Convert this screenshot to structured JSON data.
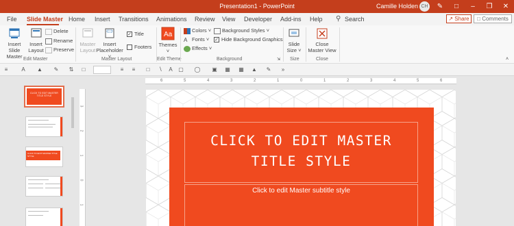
{
  "titlebar": {
    "title": "Presentation1  -  PowerPoint",
    "user_name": "Camille Holden",
    "avatar_initials": "CH"
  },
  "tabs": [
    {
      "label": "File"
    },
    {
      "label": "Slide Master"
    },
    {
      "label": "Home"
    },
    {
      "label": "Insert"
    },
    {
      "label": "Transitions"
    },
    {
      "label": "Animations"
    },
    {
      "label": "Review"
    },
    {
      "label": "View"
    },
    {
      "label": "Developer"
    },
    {
      "label": "Add-ins"
    },
    {
      "label": "Help"
    }
  ],
  "search_label": "Search",
  "share_label": "Share",
  "comments_label": "Comments",
  "ribbon": {
    "edit_master": {
      "label": "Edit Master",
      "insert_slide_master": "Insert Slide\nMaster",
      "insert_layout": "Insert\nLayout",
      "delete": "Delete",
      "rename": "Rename",
      "preserve": "Preserve"
    },
    "master_layout": {
      "label": "Master Layout",
      "master_layout_btn": "Master\nLayout",
      "insert_placeholder": "Insert\nPlaceholder",
      "title_cb": "Title",
      "footers_cb": "Footers"
    },
    "edit_theme": {
      "label": "Edit Theme",
      "themes": "Themes"
    },
    "background": {
      "label": "Background",
      "colors": "Colors",
      "fonts": "Fonts",
      "effects": "Effects",
      "background_styles": "Background Styles",
      "hide_bg_graphics": "Hide Background Graphics"
    },
    "size": {
      "label": "Size",
      "slide_size": "Slide\nSize"
    },
    "close": {
      "label": "Close",
      "close_master_view": "Close\nMaster View"
    }
  },
  "ruler_numbers": [
    "6",
    "5",
    "4",
    "3",
    "2",
    "1",
    "0",
    "1",
    "2",
    "3",
    "4",
    "5",
    "6"
  ],
  "vruler_numbers": [
    "3",
    "2",
    "1",
    "0",
    "1"
  ],
  "thumbs": {
    "master_title": "CLICK TO EDIT MASTER TITLE STYLE",
    "layout2_title": "CLICK TO EDIT MASTER TITLE STYLE"
  },
  "slide": {
    "title_placeholder": "CLICK TO EDIT MASTER TITLE STYLE",
    "subtitle_placeholder": "Click to edit Master subtitle style"
  },
  "colors": {
    "accent": "#c43e1c",
    "slide_orange": "#f04a1f"
  },
  "icons": [
    "undo-icon",
    "pen-icon",
    "ribbon-display-icon",
    "minimize-icon",
    "restore-icon",
    "close-icon"
  ]
}
